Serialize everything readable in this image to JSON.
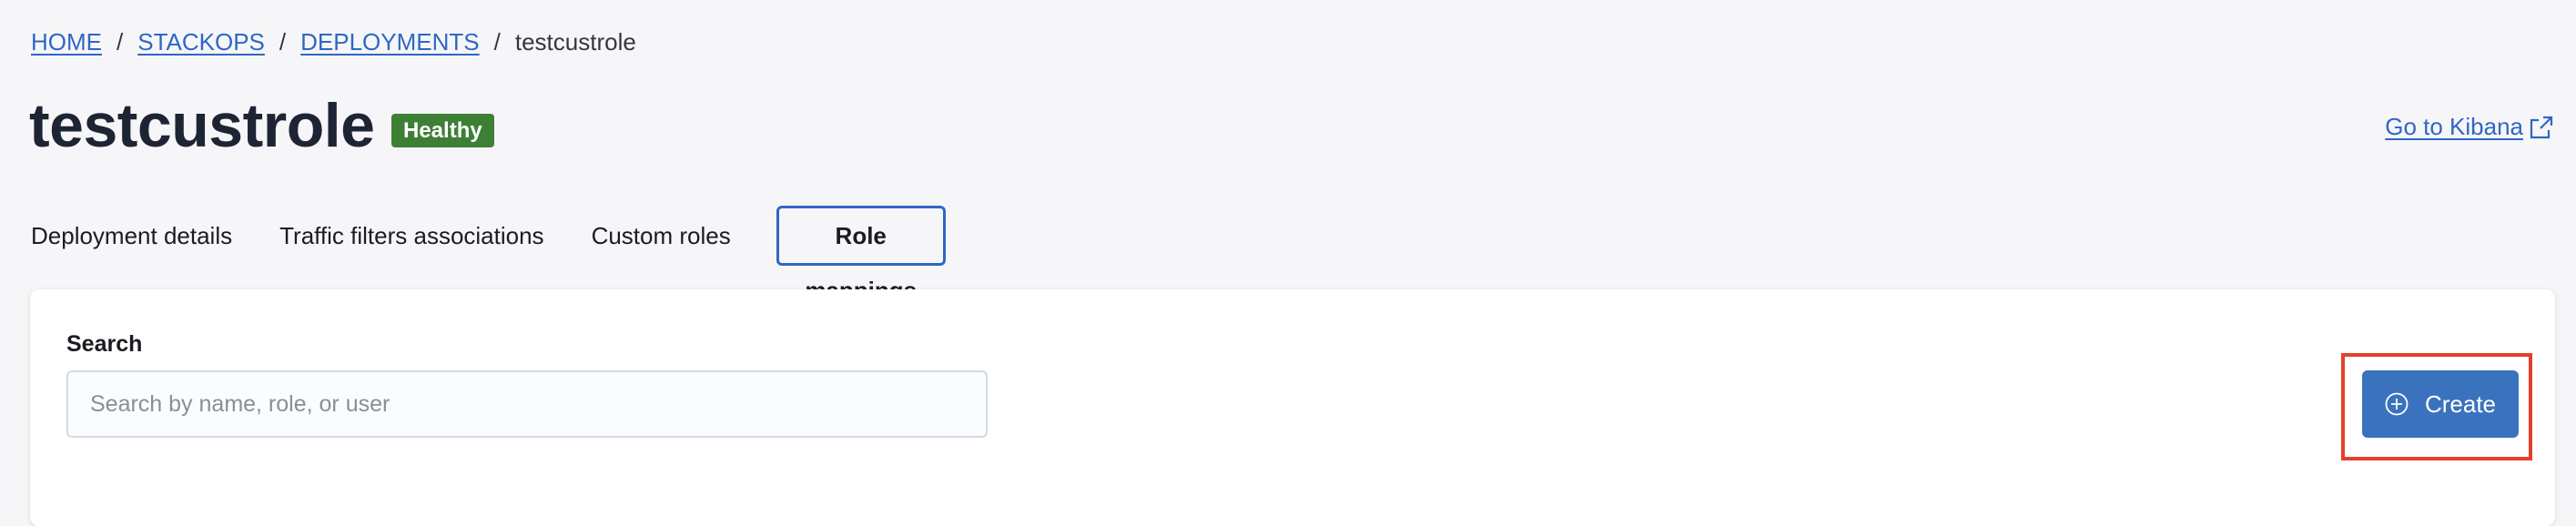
{
  "breadcrumb": {
    "items": [
      {
        "label": "HOME",
        "link": true
      },
      {
        "label": "STACKOPS",
        "link": true
      },
      {
        "label": "DEPLOYMENTS",
        "link": true
      },
      {
        "label": "testcustrole",
        "link": false
      }
    ],
    "separator": "/"
  },
  "header": {
    "title": "testcustrole",
    "status_badge": "Healthy",
    "status_color": "#3e7f36",
    "kibana_link": "Go to Kibana",
    "kibana_icon": "external-link-icon"
  },
  "tabs": [
    {
      "label": "Deployment details",
      "active": false
    },
    {
      "label": "Traffic filters associations",
      "active": false
    },
    {
      "label": "Custom roles",
      "active": false
    },
    {
      "label": "Role mappings",
      "active": true
    }
  ],
  "panel": {
    "search_label": "Search",
    "search_placeholder": "Search by name, role, or user",
    "search_value": "",
    "create_label": "Create",
    "create_icon": "plus-circle-icon"
  },
  "colors": {
    "accent": "#2f67c4",
    "button": "#3b72bd",
    "highlight": "#e2412b",
    "background": "#f6f6f8"
  }
}
